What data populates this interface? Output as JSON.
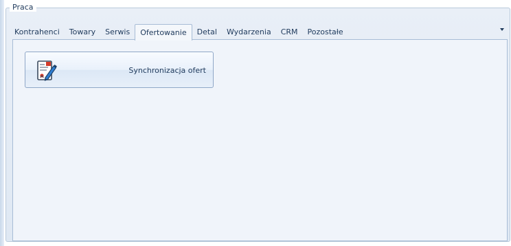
{
  "group": {
    "title": "Praca"
  },
  "tabs": [
    {
      "label": "Kontrahenci",
      "active": false
    },
    {
      "label": "Towary",
      "active": false
    },
    {
      "label": "Serwis",
      "active": false
    },
    {
      "label": "Ofertowanie",
      "active": true
    },
    {
      "label": "Detal",
      "active": false
    },
    {
      "label": "Wydarzenia",
      "active": false
    },
    {
      "label": "CRM",
      "active": false
    },
    {
      "label": "Pozostałe",
      "active": false
    }
  ],
  "panel": {
    "button": {
      "label": "Synchronizacja ofert",
      "icon": "document-pen-icon"
    }
  },
  "colors": {
    "text": "#1e395b",
    "border": "#a7bcd6",
    "panel_bg": "#f0f4fa",
    "frame_bg": "#e4ecf6"
  }
}
